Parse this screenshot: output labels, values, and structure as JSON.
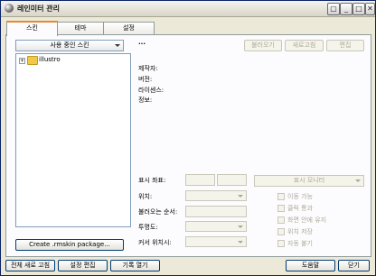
{
  "window": {
    "title": "레인미터 관리",
    "controls": [
      "▢",
      "_",
      "□",
      "✕"
    ]
  },
  "tabs": [
    {
      "label": "스킨",
      "active": true
    },
    {
      "label": "테마",
      "active": false
    },
    {
      "label": "설정",
      "active": false
    }
  ],
  "skins": {
    "dropdown_label": "사용 중인 스킨",
    "tree": [
      {
        "label": "illustro",
        "icon": "folder-icon",
        "expand": "+"
      }
    ],
    "create_package_label": "Create .rmskin package..."
  },
  "details": {
    "skin_name": "...",
    "load_button": "불러오기",
    "refresh_button": "새로고침",
    "edit_button": "편집",
    "author_label": "제작자:",
    "version_label": "버전:",
    "license_label": "라이센스:",
    "info_label": "정보:"
  },
  "settings": {
    "coords_label": "표시 좌표:",
    "display_monitor_label": "표시 모니터",
    "position_label": "위치:",
    "load_order_label": "불러오는 순서:",
    "transparency_label": "투명도:",
    "hover_label": "커서 위치시:",
    "checkboxes": [
      "이동 가능",
      "클릭 통과",
      "화면 안에 유지",
      "위치 저장",
      "자동 붙기"
    ]
  },
  "footer": {
    "refresh_all": "전체 새로 고침",
    "edit_settings": "설정 편집",
    "open_log": "기록 열기",
    "help": "도움말",
    "close": "닫기"
  }
}
